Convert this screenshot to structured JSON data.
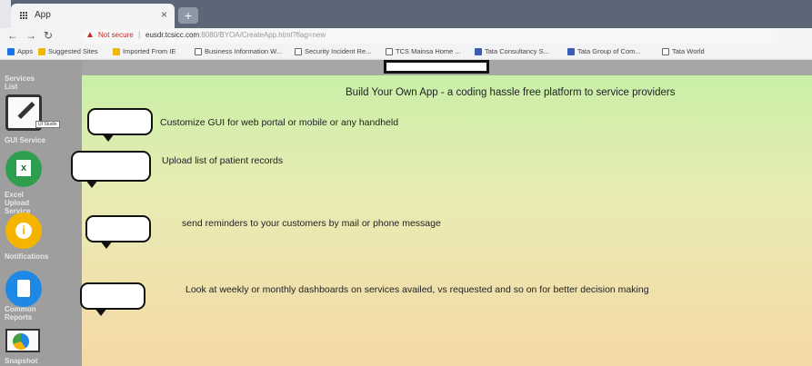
{
  "browser": {
    "tab_title": "App",
    "tab_close": "×",
    "new_tab": "+",
    "address": {
      "secure_label": "Not secure",
      "url_host": "eusdr.tcsicc.com",
      "url_path": ":8080/BYOA/CreateApp.html?flag=new"
    },
    "bookmarks": [
      "Apps",
      "Suggested Sites",
      "Imported From IE",
      "Business Information W...",
      "Security Incident Re...",
      "TCS Mainsa Home ...",
      "Tata Consultancy S...",
      "Tata Group of Com...",
      "Tata World"
    ]
  },
  "sidebar": {
    "items": [
      {
        "label": "Services List"
      },
      {
        "label": "GUI Service",
        "icon": "edit-pen-icon",
        "tooltip": "UI Studio"
      },
      {
        "label": "Excel Upload Service",
        "icon": "excel-icon"
      },
      {
        "label": "Notifications",
        "icon": "info-icon"
      },
      {
        "label": "Common Reports",
        "icon": "clipboard-icon"
      },
      {
        "label": "Snapshot",
        "icon": "pie-chart-icon"
      }
    ]
  },
  "main": {
    "headline": "Build Your Own App - a coding hassle free platform to service providers",
    "features": [
      "Customize GUI for web portal or mobile or any handheld",
      "Upload list of patient records",
      "send reminders to your customers by mail or phone message",
      "Look at weekly or monthly dashboards on services availed, vs requested and so on for better decision making"
    ]
  },
  "colors": {
    "sidebar": "#9e9e9e",
    "gradient_top": "#c5f0a6",
    "gradient_bottom": "#f5d9a6",
    "tabstrip": "#5b6677"
  }
}
